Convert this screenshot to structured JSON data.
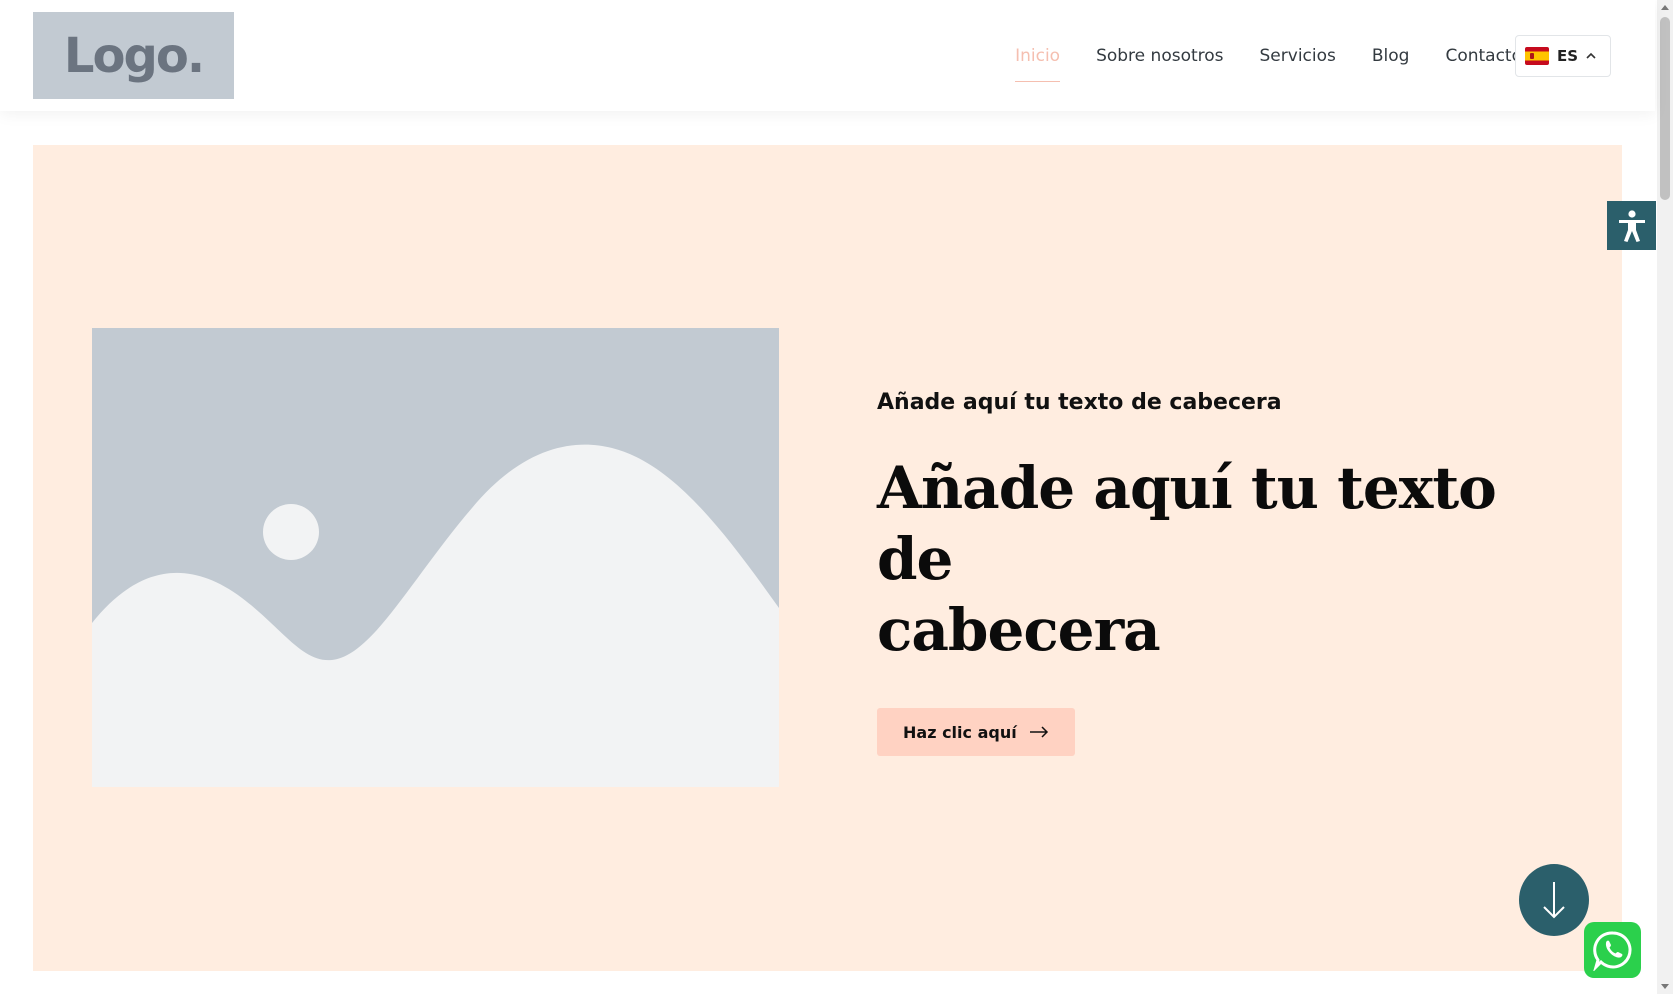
{
  "header": {
    "logo_text": "Logo.",
    "nav": [
      {
        "label": "Inicio",
        "active": true
      },
      {
        "label": "Sobre nosotros",
        "active": false
      },
      {
        "label": "Servicios",
        "active": false
      },
      {
        "label": "Blog",
        "active": false
      },
      {
        "label": "Contacto",
        "active": false
      }
    ],
    "language": {
      "code": "ES",
      "flag": "spain-flag-icon"
    }
  },
  "hero": {
    "subheading": "Añade aquí tu texto de cabecera",
    "heading_line1": "Añade aquí tu texto de",
    "heading_line2": "cabecera",
    "cta_label": "Haz clic aquí",
    "image_icon": "image-placeholder-icon"
  },
  "floating": {
    "accessibility_icon": "accessibility-icon",
    "scroll_icon": "arrow-down-icon",
    "whatsapp_icon": "whatsapp-icon"
  },
  "colors": {
    "accent": "#f5bfb0",
    "hero_bg": "#ffede0",
    "button_bg": "#ffd2c2",
    "teal": "#2b5f6b",
    "whatsapp": "#2bd04c",
    "placeholder_sky": "#c2cad2",
    "placeholder_land": "#f2f3f4"
  }
}
